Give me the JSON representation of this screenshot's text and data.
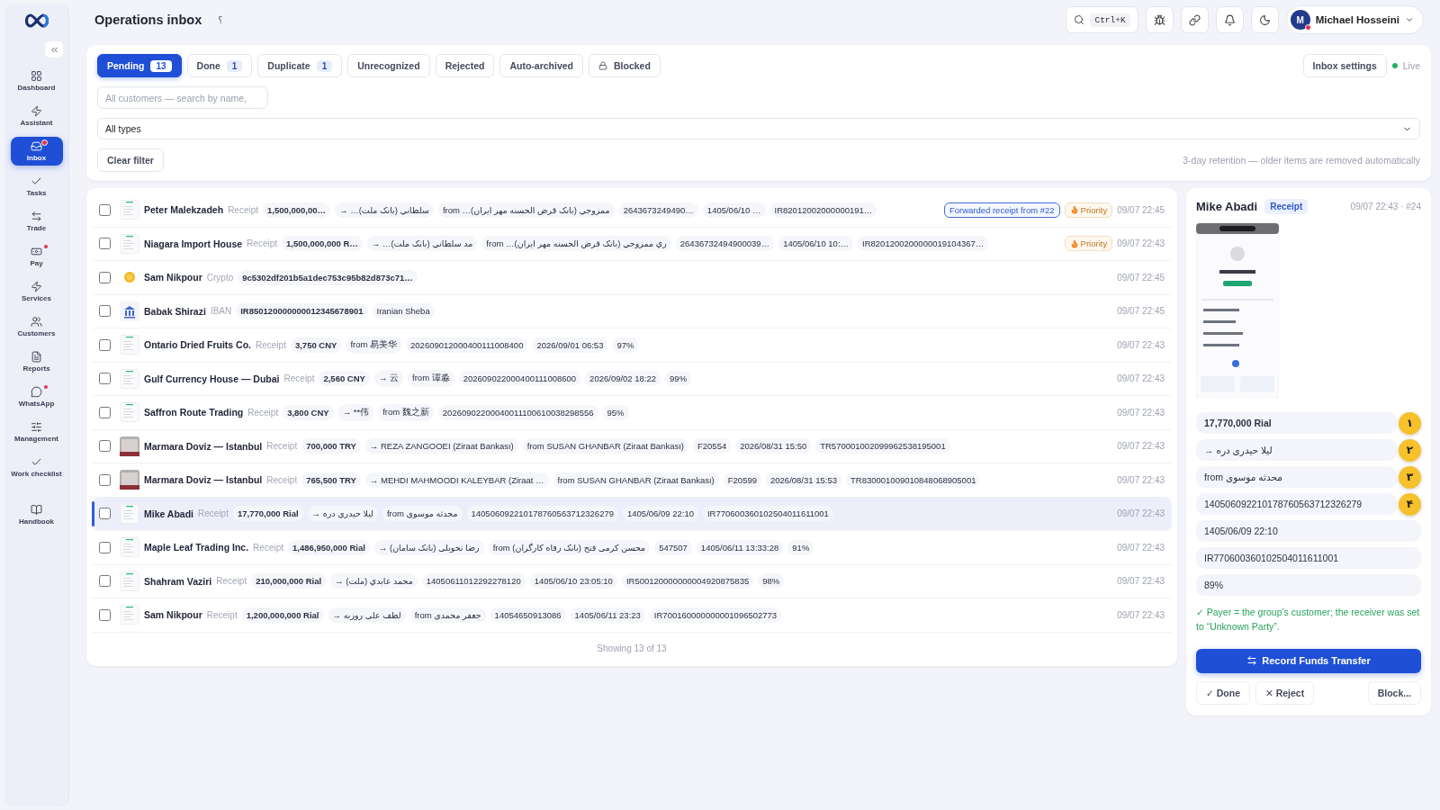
{
  "sidebar": {
    "items": [
      {
        "label": "Dashboard",
        "selected": false,
        "dot": false
      },
      {
        "label": "Assistant",
        "selected": false,
        "dot": false
      },
      {
        "label": "Inbox",
        "selected": true,
        "dot": true
      },
      {
        "label": "Tasks",
        "selected": false,
        "dot": false
      },
      {
        "label": "Trade",
        "selected": false,
        "dot": false
      },
      {
        "label": "Pay",
        "selected": false,
        "dot": true
      },
      {
        "label": "Services",
        "selected": false,
        "dot": false
      },
      {
        "label": "Customers",
        "selected": false,
        "dot": false
      },
      {
        "label": "Reports",
        "selected": false,
        "dot": false
      },
      {
        "label": "WhatsApp",
        "selected": false,
        "dot": true
      },
      {
        "label": "Management",
        "selected": false,
        "dot": false
      },
      {
        "label": "Work checklist",
        "selected": false,
        "dot": false
      },
      {
        "label": "Handbook",
        "selected": false,
        "dot": false
      }
    ]
  },
  "header": {
    "title": "Operations inbox",
    "help_mark": "؟",
    "shortcut": "Ctrl+K",
    "user": {
      "initial": "M",
      "name": "Michael Hosseini"
    }
  },
  "tabs": [
    {
      "label": "Pending",
      "count": "13",
      "selected": true
    },
    {
      "label": "Done",
      "count": "1",
      "selected": false
    },
    {
      "label": "Duplicate",
      "count": "1",
      "selected": false
    },
    {
      "label": "Unrecognized",
      "selected": false
    },
    {
      "label": "Rejected",
      "selected": false
    },
    {
      "label": "Auto-archived",
      "selected": false
    },
    {
      "label": "Blocked",
      "locked": true,
      "selected": false
    }
  ],
  "settings_button": "Inbox settings",
  "live": "Live",
  "filters": {
    "search_placeholder": "All customers — search by name,",
    "type_select": "All types",
    "clear": "Clear filter",
    "retention_note": "3-day retention — older items are removed automatically"
  },
  "rows": [
    {
      "kind": "receipt",
      "name": "Peter Malekzadeh",
      "type": "Receipt",
      "chips": [
        "1,500,000,00…",
        "→ …سلطاني (بانک ملت)",
        "from …ممزوجي (بانک قرض الحسنه مهر ایران)",
        "2643673249490…",
        "1405/06/10 …",
        "IR82012002000000191…"
      ],
      "forwarded": "Forwarded receipt from #22",
      "priority": "Priority",
      "time": "09/07 22:45",
      "checked": false,
      "selected": false
    },
    {
      "kind": "receipt",
      "name": "Niagara Import House",
      "type": "Receipt",
      "chips": [
        "1,500,000,000 R…",
        "→ …مد سلطاني (بانک ملت)",
        "from …ري ممزوجي (بانک قرض الحسنه مهر ایران)",
        "26436732494900039…",
        "1405/06/10 10:…",
        "IR8201200200000019104367…"
      ],
      "priority": "Priority",
      "time": "09/07 22:43",
      "checked": false,
      "selected": false
    },
    {
      "kind": "coin",
      "name": "Sam Nikpour",
      "type": "Crypto",
      "chips": [
        "9c5302df201b5a1dec753c95b82d873c71…"
      ],
      "time": "09/07 22:45",
      "checked": false,
      "selected": false
    },
    {
      "kind": "bank",
      "name": "Babak Shirazi",
      "type": "IBAN",
      "chips": [
        "IR850120000000012345678901",
        "Iranian Sheba"
      ],
      "time": "09/07 22:45",
      "checked": false,
      "selected": false
    },
    {
      "kind": "receipt",
      "name": "Ontario Dried Fruits Co.",
      "type": "Receipt",
      "chips": [
        "3,750 CNY",
        "from 易美华",
        "202609012000400111008400",
        "2026/09/01 06:53",
        "97%"
      ],
      "time": "09/07 22:43",
      "checked": false,
      "selected": false
    },
    {
      "kind": "receipt",
      "name": "Gulf Currency House — Dubai",
      "type": "Receipt",
      "chips": [
        "2,560 CNY",
        "→ 云",
        "from 谭淼",
        "202609022000400111008600",
        "2026/09/02 18:22",
        "99%"
      ],
      "time": "09/07 22:43",
      "checked": false,
      "selected": false
    },
    {
      "kind": "receipt",
      "name": "Saffron Route Trading",
      "type": "Receipt",
      "chips": [
        "3,800 CNY",
        "→ **伟",
        "from 魏之新",
        "20260902200040011100610038298556",
        "95%"
      ],
      "time": "09/07 22:43",
      "checked": false,
      "selected": false
    },
    {
      "name": "Marmara Doviz — Istanbul",
      "type": "Receipt",
      "chips": [
        "700,000 TRY",
        "→ REZA ZANGOOEI (Ziraat Bankası)",
        "from SUSAN GHANBAR (Ziraat Bankası)",
        "F20554",
        "2026/08/31 15:50",
        "TR570001002099962538195001"
      ],
      "time": "09/07 22:43",
      "checked": false,
      "selected": false
    },
    {
      "name": "Marmara Doviz — Istanbul",
      "type": "Receipt",
      "chips": [
        "765,500 TRY",
        "→ MEHDI MAHMOODI KALEYBAR (Ziraat …",
        "from SUSAN GHANBAR (Ziraat Bankası)",
        "F20599",
        "2026/08/31 15:53",
        "TR830001009010848068905001"
      ],
      "time": "09/07 22:43",
      "checked": false,
      "selected": false
    },
    {
      "kind": "receipt",
      "name": "Mike Abadi",
      "type": "Receipt",
      "chips": [
        "17,770,000 Rial",
        "→ ليلا حيدری دره",
        "from محدثه موسوی",
        "140506092210178760563712326279",
        "1405/06/09 22:10",
        "IR770600360102504011611001"
      ],
      "time": "09/07 22:43",
      "checked": false,
      "selected": true
    },
    {
      "kind": "receipt",
      "name": "Maple Leaf Trading Inc.",
      "type": "Receipt",
      "chips": [
        "1,486,950,000 Rial",
        "→ رضا تحویلی (بانک سامان)",
        "from محسن کرمی فتح (بانک رفاه کارگران)",
        "547507",
        "1405/06/11 13:33:28",
        "91%"
      ],
      "time": "09/07 22:43",
      "checked": false,
      "selected": false
    },
    {
      "kind": "receipt",
      "name": "Shahram Vaziri",
      "type": "Receipt",
      "chips": [
        "210,000,000 Rial",
        "→ محمد عابدي (ملت)",
        "14050611012292278120",
        "1405/06/10 23:05:10",
        "IR500120000000004920875835",
        "98%"
      ],
      "time": "09/07 22:43",
      "checked": false,
      "selected": false
    },
    {
      "kind": "receipt",
      "name": "Sam Nikpour",
      "type": "Receipt",
      "chips": [
        "1,200,000,000 Rial",
        "→ لطف علی روزبه",
        "from جعفر محمدی",
        "14054650913086",
        "1405/06/11 23:23",
        "IR700160000000001096502773"
      ],
      "time": "09/07 22:43",
      "checked": false,
      "selected": false
    }
  ],
  "footer": "Showing 13 of 13",
  "detail": {
    "name": "Mike Abadi",
    "type": "Receipt",
    "meta": "09/07 22:43 · #24",
    "fields": [
      {
        "text": "17,770,000 Rial",
        "marker": "١"
      },
      {
        "text": "→ ليلا حيدری دره",
        "marker": "٢"
      },
      {
        "text": "from محدثه موسوی",
        "marker": "٣"
      },
      {
        "text": "140506092210178760563712326279",
        "marker": "۴"
      },
      {
        "text": "1405/06/09 22:10"
      },
      {
        "text": "IR770600360102504011611001"
      },
      {
        "text": "89%"
      }
    ],
    "note": "✓ Payer = the group’s customer; the receiver was set to “Unknown Party”.",
    "primary": "Record Funds Transfer",
    "done": "✓ Done",
    "reject": "✕ Reject",
    "block": "Block..."
  }
}
